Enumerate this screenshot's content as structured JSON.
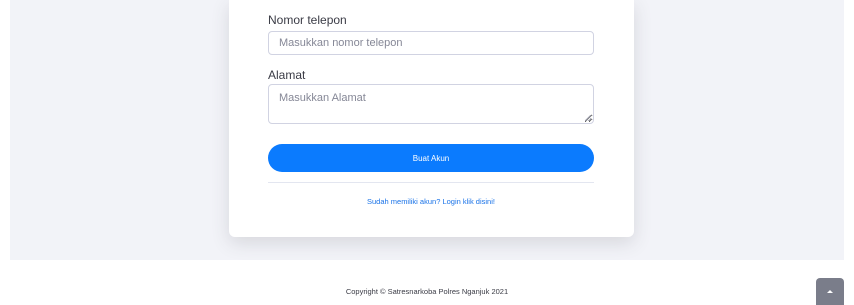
{
  "form": {
    "phone": {
      "label": "Nomor telepon",
      "placeholder": "Masukkan nomor telepon",
      "value": ""
    },
    "address": {
      "label": "Alamat",
      "placeholder": "Masukkan Alamat",
      "value": ""
    },
    "submit_label": "Buat Akun",
    "login_link": "Sudah memiliki akun? Login klik disini!"
  },
  "footer": {
    "copyright": "Copyright © Satresnarkoba Polres Nganjuk 2021"
  },
  "icons": {
    "scroll_top": "chevron-up-icon"
  },
  "colors": {
    "primary": "#0b7bfe",
    "link": "#1a73e8",
    "background": "#f2f3f8",
    "scroll_button": "#7a7d8a"
  }
}
